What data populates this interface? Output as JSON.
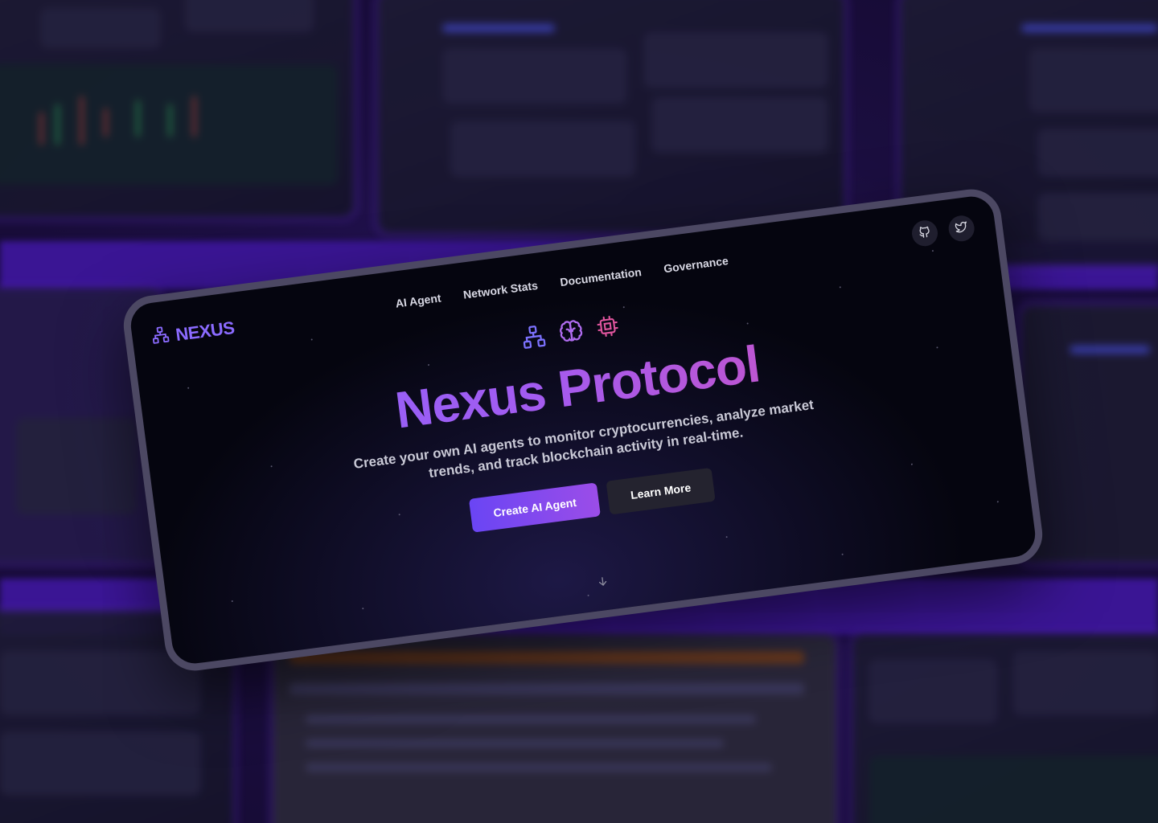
{
  "brand": {
    "name": "NEXUS",
    "logo_icon": "network-icon"
  },
  "nav": {
    "items": [
      {
        "label": "AI Agent"
      },
      {
        "label": "Network Stats"
      },
      {
        "label": "Documentation"
      },
      {
        "label": "Governance"
      }
    ]
  },
  "social": {
    "icons": [
      "github-icon",
      "twitter-icon"
    ]
  },
  "hero": {
    "icons": [
      "network-icon",
      "brain-icon",
      "cpu-icon"
    ],
    "title": "Nexus Protocol",
    "subtitle": "Create your own AI agents to monitor cryptocurrencies, analyze market trends, and track blockchain activity in real-time.",
    "primary_cta": "Create AI Agent",
    "secondary_cta": "Learn More",
    "scroll_icon": "arrow-down-icon"
  },
  "colors": {
    "accent": "#8b6bff",
    "gradient_start": "#8766ff",
    "gradient_end": "#d94fb1",
    "background": "#05050f"
  }
}
